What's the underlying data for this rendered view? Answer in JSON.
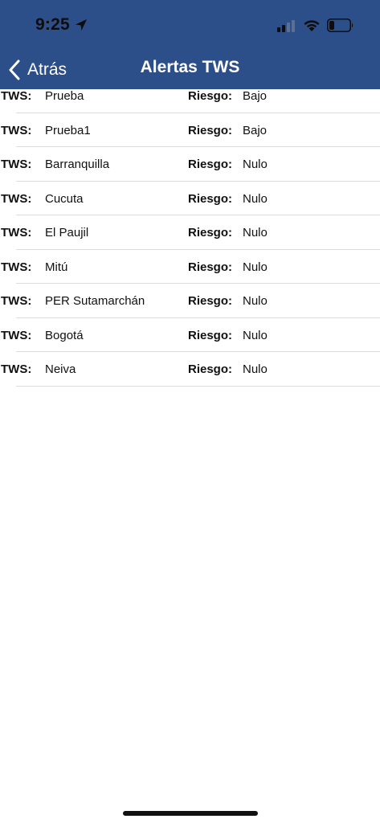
{
  "status_bar": {
    "time": "9:25"
  },
  "nav": {
    "back_label": "Atrás",
    "title": "Alertas TWS"
  },
  "labels": {
    "tws": "TWS:",
    "risk": "Riesgo:"
  },
  "alerts": [
    {
      "name": "Prueba",
      "risk": "Bajo"
    },
    {
      "name": "Prueba1",
      "risk": "Bajo"
    },
    {
      "name": "Barranquilla",
      "risk": "Nulo"
    },
    {
      "name": "Cucuta",
      "risk": "Nulo"
    },
    {
      "name": "El Paujil",
      "risk": "Nulo"
    },
    {
      "name": "Mitú",
      "risk": "Nulo"
    },
    {
      "name": "PER Sutamarchán",
      "risk": "Nulo"
    },
    {
      "name": "Bogotá",
      "risk": "Nulo"
    },
    {
      "name": "Neiva",
      "risk": "Nulo"
    }
  ],
  "colors": {
    "nav_background": "#2c4f8a",
    "nav_text": "#ffffff",
    "separator": "#dcdcdc"
  }
}
